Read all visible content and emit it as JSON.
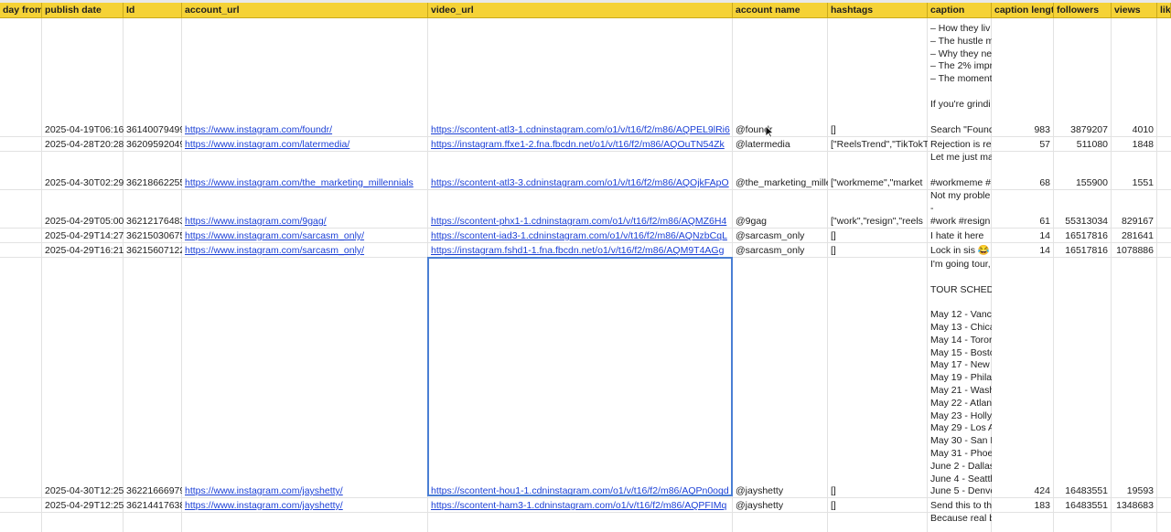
{
  "headers": [
    "day from",
    "publish date",
    "Id",
    "account_url",
    "video_url",
    "account name",
    "hashtags",
    "caption",
    "caption length",
    "followers",
    "views",
    "lik"
  ],
  "caption_lines_a": [
    "– How they liv",
    "– The hustle m",
    "– Why they ne",
    "– The 2% impr",
    "– The moment",
    "",
    "If you're grindi"
  ],
  "caption_lines_b": [
    "Let me just ma"
  ],
  "caption_lines_c": [
    "Not my proble",
    "-"
  ],
  "caption_lines_d": [
    "I'm going tour,",
    "",
    "TOUR SCHEDU",
    "",
    "May 12 - Vanc",
    "May 13 - Chica",
    "May 14 - Toror",
    "May 15 - Bostc",
    "May 17 - New",
    "May 19 - Phila",
    "May 21 - Wash",
    "May 22 - Atlan",
    "May 23 - Holly",
    "May 29 - Los A",
    "May 30 - San F",
    "May 31 - Phoe",
    "June 2 - Dallas",
    "June 4 - Seattl"
  ],
  "caption_lines_e": [
    "Because real b"
  ],
  "rows": [
    {
      "publish_date": "2025-04-19T06:16:",
      "id": "36140079499",
      "account_url": "https://www.instagram.com/foundr/",
      "video_url": "https://scontent-atl3-1.cdninstagram.com/o1/v/t16/f2/m86/AQPEL9lRi6",
      "account_name": "@foundr",
      "hashtags": "[]",
      "caption": "Search \"Found",
      "caption_length": "983",
      "followers": "3879207",
      "views": "4010"
    },
    {
      "publish_date": "2025-04-28T20:28:",
      "id": "36209592049",
      "account_url": "https://www.instagram.com/latermedia/",
      "video_url": "https://instagram.ffxe1-2.fna.fbcdn.net/o1/v/t16/f2/m86/AQOuTN54Zk",
      "account_name": "@latermedia",
      "hashtags": "[\"ReelsTrend\",\"TikTokTr",
      "caption": "Rejection is re",
      "caption_length": "57",
      "followers": "511080",
      "views": "1848"
    },
    {
      "publish_date": "2025-04-30T02:29:",
      "id": "36218662255",
      "account_url": "https://www.instagram.com/the_marketing_millennials",
      "video_url": "https://scontent-atl3-3.cdninstagram.com/o1/v/t16/f2/m86/AQOjkFApO",
      "account_name": "@the_marketing_mille",
      "hashtags": "[\"workmeme\",\"market",
      "caption": "#workmeme #",
      "caption_length": "68",
      "followers": "155900",
      "views": "1551"
    },
    {
      "publish_date": "2025-04-29T05:00:",
      "id": "36212176483",
      "account_url": "https://www.instagram.com/9gag/",
      "video_url": "https://scontent-phx1-1.cdninstagram.com/o1/v/t16/f2/m86/AQMZ6H4",
      "account_name": "@9gag",
      "hashtags": "[\"work\",\"resign\",\"reels",
      "caption": "#work #resign",
      "caption_length": "61",
      "followers": "55313034",
      "views": "829167"
    },
    {
      "publish_date": "2025-04-29T14:27:",
      "id": "36215030675",
      "account_url": "https://www.instagram.com/sarcasm_only/",
      "video_url": "https://scontent-iad3-1.cdninstagram.com/o1/v/t16/f2/m86/AQNzbCqL",
      "account_name": "@sarcasm_only",
      "hashtags": "[]",
      "caption": "I hate it here",
      "caption_length": "14",
      "followers": "16517816",
      "views": "281641"
    },
    {
      "publish_date": "2025-04-29T16:21:",
      "id": "36215607122",
      "account_url": "https://www.instagram.com/sarcasm_only/",
      "video_url": "https://instagram.fshd1-1.fna.fbcdn.net/o1/v/t16/f2/m86/AQM9T4AGg",
      "account_name": "@sarcasm_only",
      "hashtags": "[]",
      "caption": "Lock in sis 😂",
      "caption_length": "14",
      "followers": "16517816",
      "views": "1078886"
    },
    {
      "publish_date": "2025-04-30T12:25:",
      "id": "36221666979",
      "account_url": "https://www.instagram.com/jayshetty/",
      "video_url": "https://scontent-hou1-1.cdninstagram.com/o1/v/t16/f2/m86/AQPn0ogd",
      "account_name": "@jayshetty",
      "hashtags": "[]",
      "caption": "June 5 - Denve",
      "caption_length": "424",
      "followers": "16483551",
      "views": "19593"
    },
    {
      "publish_date": "2025-04-29T12:25:",
      "id": "36214417638",
      "account_url": "https://www.instagram.com/jayshetty/",
      "video_url": "https://scontent-ham3-1.cdninstagram.com/o1/v/t16/f2/m86/AQPFIMq",
      "account_name": "@jayshetty",
      "hashtags": "[]",
      "caption": "Send this to th",
      "caption_length": "183",
      "followers": "16483551",
      "views": "1348683"
    }
  ]
}
